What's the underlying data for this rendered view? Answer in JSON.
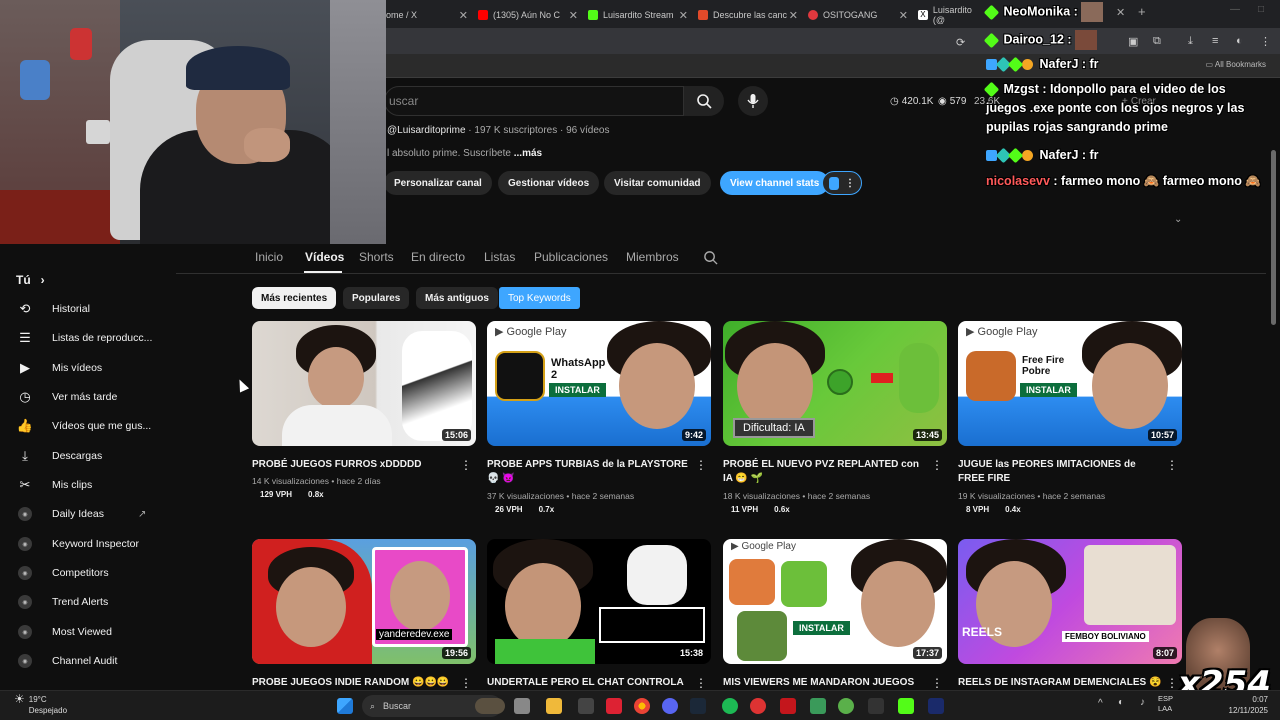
{
  "browser": {
    "tabs": [
      {
        "label": "ome / X"
      },
      {
        "label": "(1305) Aún No C"
      },
      {
        "label": "Luisardito Stream"
      },
      {
        "label": "Descubre las canc"
      },
      {
        "label": "OSITOGANG"
      },
      {
        "label": "Luisardito (@"
      }
    ],
    "all_bookmarks": "All Bookmarks"
  },
  "header": {
    "search_placeholder": "uscar",
    "stat_views": "420.1K",
    "stat_videos": "579",
    "stat_subs": "23.6K",
    "create_label": "Crear"
  },
  "channel": {
    "handle": "@Luisarditoprime",
    "subs": "197 K suscriptores",
    "videos_count": "96 vídeos",
    "desc": "l absoluto prime. Suscríbete",
    "more": "...más",
    "buttons": {
      "customize": "Personalizar canal",
      "manage": "Gestionar vídeos",
      "community": "Visitar comunidad",
      "stats": "View channel stats"
    }
  },
  "tabs": [
    "Inicio",
    "Vídeos",
    "Shorts",
    "En directo",
    "Listas",
    "Publicaciones",
    "Miembros"
  ],
  "filters": [
    "Más recientes",
    "Populares",
    "Más antiguos",
    "Top Keywords"
  ],
  "sidebar": {
    "you": "Tú",
    "items": [
      "Historial",
      "Listas de reproducc...",
      "Mis vídeos",
      "Ver más tarde",
      "Vídeos que me gus...",
      "Descargas",
      "Mis clips",
      "Daily Ideas",
      "Keyword Inspector",
      "Competitors",
      "Trend Alerts",
      "Most Viewed",
      "Channel Audit"
    ]
  },
  "videos": [
    {
      "title": "PROBÉ JUEGOS FURROS xDDDDD",
      "duration": "15:06",
      "views": "14 K visualizaciones",
      "ago": "hace 2 días",
      "vph": "129 VPH",
      "ratio": "0.8x"
    },
    {
      "title": "PROBE APPS TURBIAS de la PLAYSTORE 💀 👿",
      "duration": "9:42",
      "views": "37 K visualizaciones",
      "ago": "hace 2 semanas",
      "vph": "26 VPH",
      "ratio": "0.7x"
    },
    {
      "title": "PROBÉ EL NUEVO PVZ REPLANTED con IA 😁 🌱",
      "duration": "13:45",
      "views": "18 K visualizaciones",
      "ago": "hace 2 semanas",
      "vph": "11 VPH",
      "ratio": "0.6x"
    },
    {
      "title": "JUGUE las PEORES IMITACIONES de FREE FIRE",
      "duration": "10:57",
      "views": "19 K visualizaciones",
      "ago": "hace 2 semanas",
      "vph": "8 VPH",
      "ratio": "0.4x"
    },
    {
      "title": "PROBE JUEGOS INDIE RANDOM 😀😀😀",
      "duration": "19:56",
      "views": "",
      "ago": "",
      "vph": "",
      "ratio": ""
    },
    {
      "title": "UNDERTALE PERO EL CHAT CONTROLA EL",
      "duration": "15:38",
      "views": "",
      "ago": "",
      "vph": "",
      "ratio": ""
    },
    {
      "title": "MIS VIEWERS ME MANDARON JUEGOS",
      "duration": "17:37",
      "views": "",
      "ago": "",
      "vph": "",
      "ratio": ""
    },
    {
      "title": "REELS DE INSTAGRAM DEMENCIALES 😵",
      "duration": "8:07",
      "views": "",
      "ago": "",
      "vph": "",
      "ratio": ""
    }
  ],
  "thumb_text": {
    "google_play": "Google Play",
    "whatsapp": "WhatsApp 2",
    "instalar": "INSTALAR",
    "dificultad": "Dificultad: IA",
    "freefire": "Free Fire Pobre",
    "yandere": "yanderedev.exe",
    "reels": "REELS",
    "femboy": "FEMBOY BOLIVIANO"
  },
  "chat": [
    {
      "user": "NeoMonika",
      "sep": " :",
      "msg": ""
    },
    {
      "user": "Dairoo_12",
      "sep": " :",
      "msg": ""
    },
    {
      "user": "NaferJ",
      "sep": " :",
      "msg": " fr"
    },
    {
      "user": "Mzgst",
      "sep": " :",
      "msg": " Idonpollo para el video de los juegos .exe ponte con los ojos negros y las pupilas rojas sangrando prime"
    },
    {
      "user": "NaferJ",
      "sep": " :",
      "msg": " fr"
    },
    {
      "user": "nicolasevv",
      "sep": " :",
      "msg": " farmeo mono 🙈 farmeo mono 🙈"
    }
  ],
  "overlay": {
    "emote_count": "x254"
  },
  "taskbar": {
    "temp": "19°C",
    "weather": "Despejado",
    "search": "Buscar",
    "lang1": "ESP",
    "lang2": "LAA",
    "time": "0:07",
    "date": "12/11/2025"
  },
  "colors": {
    "accent": "#3ea6ff",
    "bg": "#0f0f0f",
    "chip": "#272727"
  }
}
